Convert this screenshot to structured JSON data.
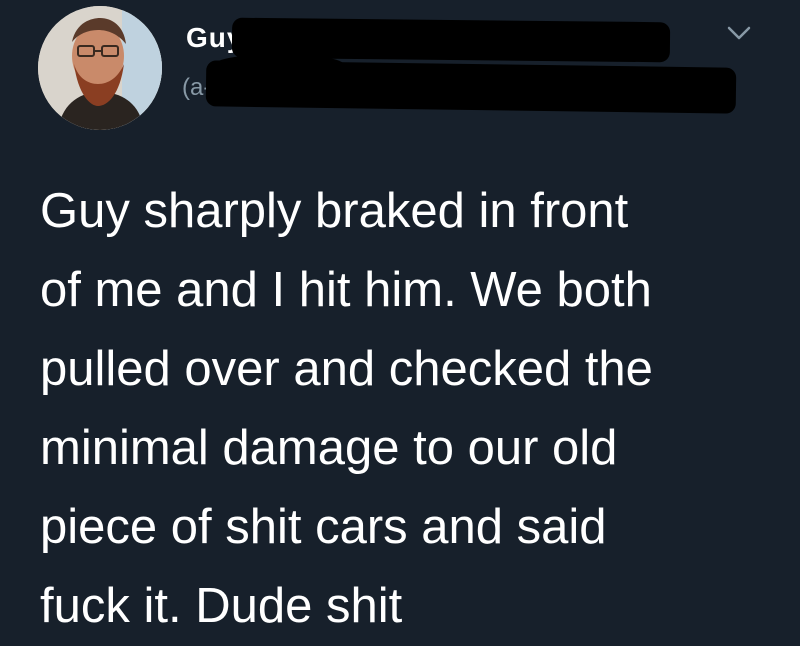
{
  "header": {
    "display_name": "Guy",
    "name_trailing": ".... ...",
    "handle": "(a-",
    "menu_icon": "chevron-down-icon"
  },
  "avatar": {
    "icon": "profile-avatar-icon",
    "background_color": "#d9d4cc"
  },
  "tweet": {
    "text": "Guy sharply braked in front\nof me and I hit him. We both\npulled over and checked the\nminimal damage to our old\npiece of shit cars and said\nfuck it. Dude shit"
  },
  "colors": {
    "background": "#17202b",
    "text": "#ffffff",
    "secondary_text": "#8899a6",
    "redaction": "#000000"
  }
}
